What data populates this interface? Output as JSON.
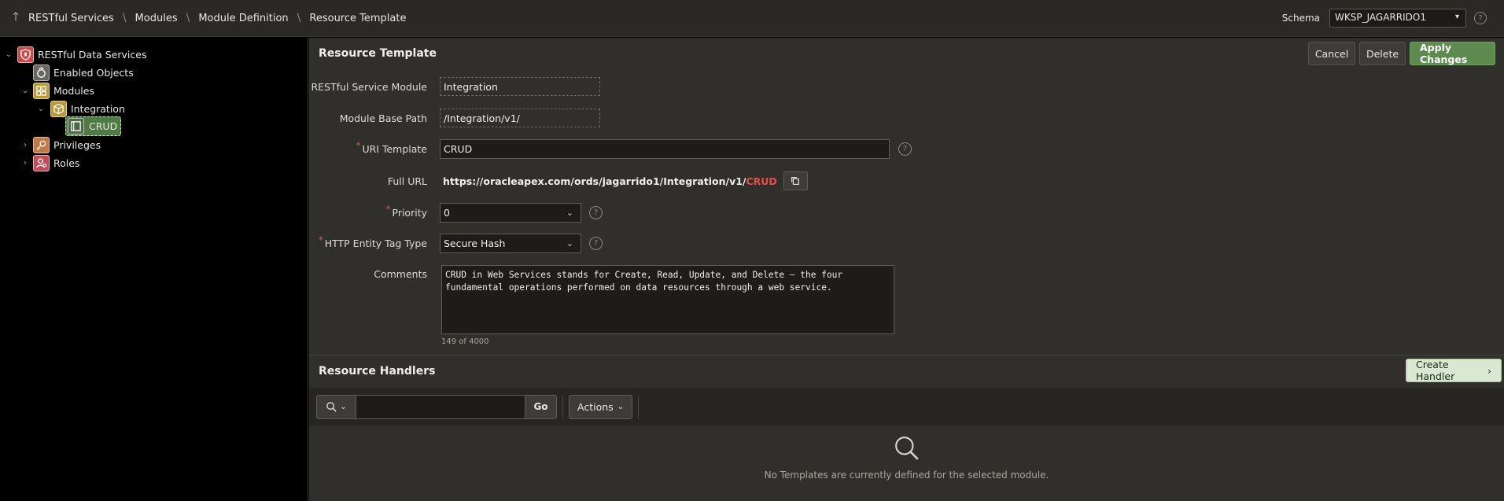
{
  "breadcrumb": {
    "items": [
      "RESTful Services",
      "Modules",
      "Module Definition",
      "Resource Template"
    ]
  },
  "schema": {
    "label": "Schema",
    "value": "WKSP_JAGARRIDO1"
  },
  "tree": {
    "root": "RESTful Data Services",
    "enabled_objects": "Enabled Objects",
    "modules": "Modules",
    "module": "Integration",
    "template": "CRUD",
    "privileges": "Privileges",
    "roles": "Roles"
  },
  "resource_template": {
    "title": "Resource Template",
    "buttons": {
      "cancel": "Cancel",
      "delete": "Delete",
      "apply": "Apply Changes"
    },
    "fields": {
      "module_label": "RESTful Service Module",
      "module_value": "Integration",
      "base_path_label": "Module Base Path",
      "base_path_value": "/Integration/v1/",
      "uri_label": "URI Template",
      "uri_value": "CRUD",
      "full_url_label": "Full URL",
      "full_url_prefix": "https://oracleapex.com/ords/jagarrido1/Integration/v1/",
      "full_url_suffix": "CRUD",
      "priority_label": "Priority",
      "priority_value": "0",
      "etag_label": "HTTP Entity Tag Type",
      "etag_value": "Secure Hash",
      "comments_label": "Comments",
      "comments_value": "CRUD in Web Services stands for Create, Read, Update, and Delete — the four fundamental operations performed on data resources through a web service.",
      "comments_counter": "149 of 4000"
    }
  },
  "resource_handlers": {
    "title": "Resource Handlers",
    "create_button": "Create Handler",
    "go_label": "Go",
    "actions_label": "Actions",
    "empty_message": "No Templates are currently defined for the selected module."
  },
  "colors": {
    "accent_green": "#5c8a4f",
    "required_red": "#e0514b",
    "selected_node": "#4f7b45"
  }
}
